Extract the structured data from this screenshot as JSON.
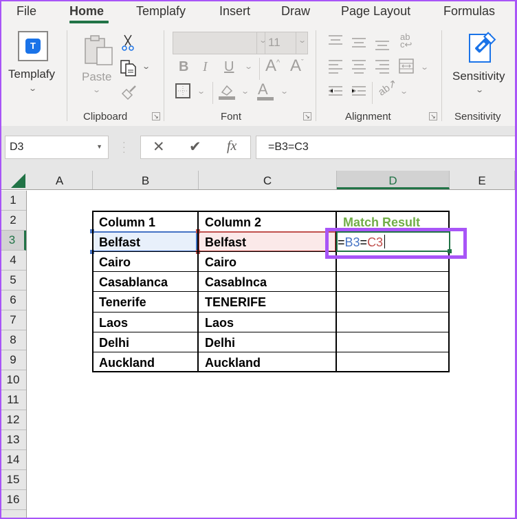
{
  "ribbon": {
    "tabs": [
      {
        "label": "File",
        "active": false
      },
      {
        "label": "Home",
        "active": true
      },
      {
        "label": "Templafy",
        "active": false
      },
      {
        "label": "Insert",
        "active": false
      },
      {
        "label": "Draw",
        "active": false
      },
      {
        "label": "Page Layout",
        "active": false
      },
      {
        "label": "Formulas",
        "active": false
      }
    ],
    "accent_color": "#217346",
    "templafy": {
      "label": "Templafy",
      "logo_letter": "T"
    },
    "clipboard": {
      "group_label": "Clipboard",
      "paste_label": "Paste"
    },
    "font": {
      "group_label": "Font",
      "font_name": "",
      "font_size": "11",
      "bold": "B",
      "italic": "I",
      "underline": "U"
    },
    "alignment": {
      "group_label": "Alignment"
    },
    "sensitivity": {
      "group_label": "Sensitivity",
      "button_label": "Sensitivity"
    }
  },
  "formula_bar": {
    "name_box": "D3",
    "cancel_icon": "✕",
    "enter_icon": "✔",
    "fx_label": "fx",
    "formula": "=B3=C3"
  },
  "grid": {
    "columns": [
      "A",
      "B",
      "C",
      "D",
      "E"
    ],
    "selected_column": "D",
    "rows": [
      "1",
      "2",
      "3",
      "4",
      "5",
      "6",
      "7",
      "8",
      "9",
      "10",
      "11",
      "12",
      "13",
      "14",
      "15",
      "16"
    ],
    "selected_row": "3"
  },
  "table": {
    "headers": [
      "Column 1",
      "Column 2",
      "Match Result"
    ],
    "rows": [
      [
        "Belfast",
        "Belfast",
        ""
      ],
      [
        "Cairo",
        "Cairo",
        ""
      ],
      [
        "Casablanca",
        "Casablnca",
        ""
      ],
      [
        "Tenerife",
        "TENERIFE",
        ""
      ],
      [
        "Laos",
        "Laos",
        ""
      ],
      [
        "Delhi",
        "Delhi",
        ""
      ],
      [
        "Auckland",
        "Auckland",
        ""
      ]
    ],
    "editing_cell": {
      "address": "D3",
      "parts": [
        "=",
        "B3",
        "=",
        "C3"
      ]
    },
    "header_color": "#70ad47",
    "ref_b_color": "#4472c4",
    "ref_c_color": "#c0504d",
    "highlight_color": "#a855f7"
  }
}
